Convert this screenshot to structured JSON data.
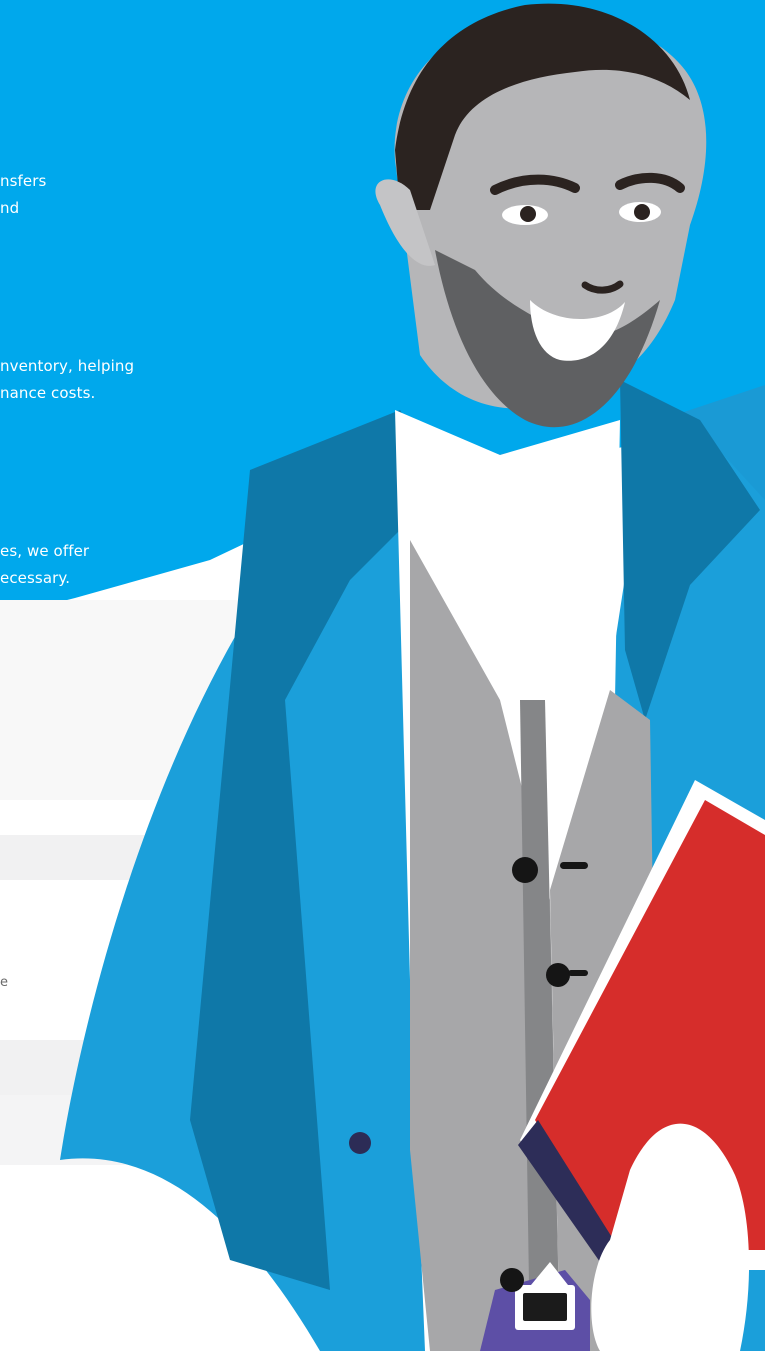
{
  "background": {
    "sky_color": "#00a8ec",
    "page_color": "#ffffff"
  },
  "left_copy": {
    "line_1": "nsfers",
    "line_2": "nd",
    "line_3": "nventory, helping",
    "line_4": "nance costs.",
    "line_5": "es, we offer",
    "line_6": "ecessary.",
    "line_7": "e"
  },
  "illustration": {
    "subject": "man-holding-red-book",
    "jacket_color": "#1b9fda",
    "shirt_color": "#ffffff",
    "vest_color": "#a7a7a9",
    "book_color": "#d62d2b",
    "hair_color": "#2b2320"
  }
}
